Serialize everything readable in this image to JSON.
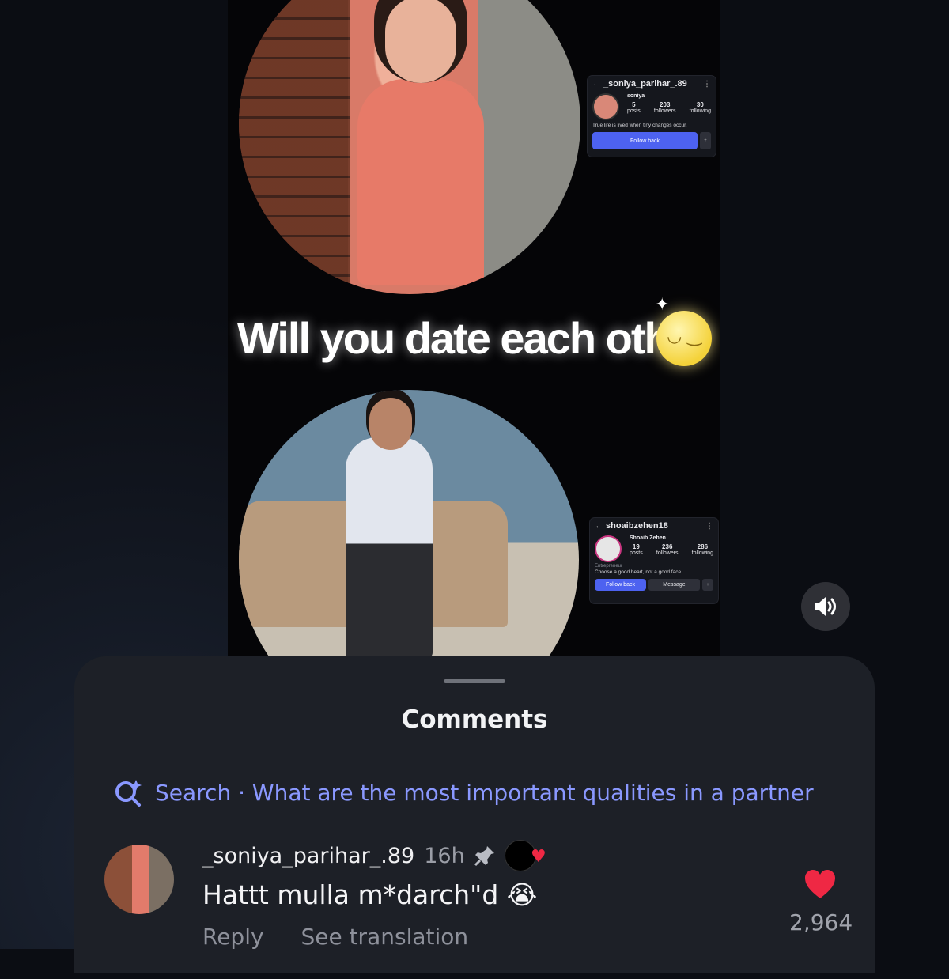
{
  "reel": {
    "overlay_text": "Will you date each other",
    "card_top": {
      "username": "_soniya_parihar_.89",
      "name": "soniya",
      "posts": "5",
      "posts_label": "posts",
      "followers": "203",
      "followers_label": "followers",
      "following": "30",
      "following_label": "following",
      "bio": "True life is lived when tiny changes occur.",
      "follow_back": "Follow back"
    },
    "card_bottom": {
      "username": "shoaibzehen18",
      "name": "Shoaib Zehen",
      "posts": "19",
      "posts_label": "posts",
      "followers": "236",
      "followers_label": "followers",
      "following": "286",
      "following_label": "following",
      "role": "Entrepreneur",
      "bio": "Choose a good heart, not a good face",
      "follow_back": "Follow back",
      "message": "Message"
    }
  },
  "sheet": {
    "title": "Comments",
    "search_label": "Search · What are the most important qualities in a partner"
  },
  "comment": {
    "username": "_soniya_parihar_.89",
    "time": "16h",
    "text": "Hattt mulla m*darch\"d 😭",
    "reply": "Reply",
    "see_translation": "See translation",
    "likes": "2,964"
  },
  "colors": {
    "accent_search": "#8a98ff",
    "follow_button": "#4d62f0",
    "like_heart": "#ef2844"
  }
}
